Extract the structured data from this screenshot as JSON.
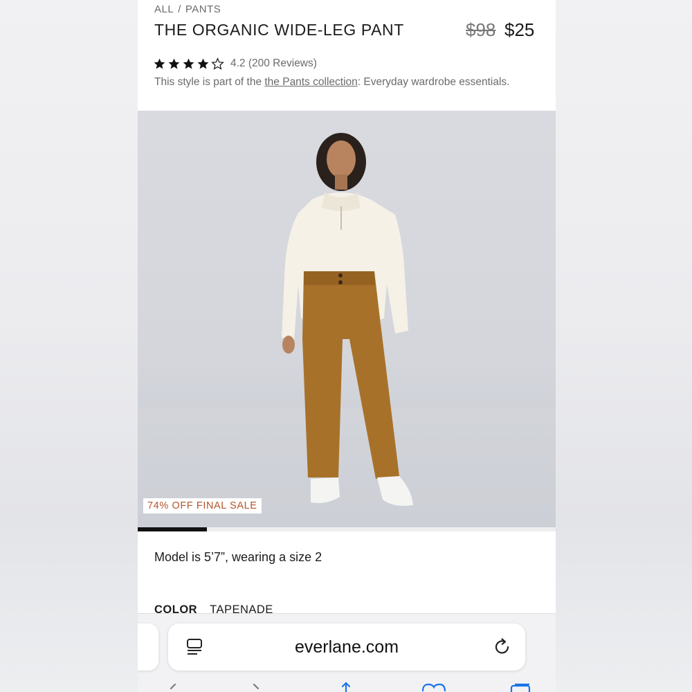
{
  "breadcrumb": {
    "all": "ALL",
    "separator": "/",
    "category": "PANTS"
  },
  "product": {
    "title": "THE ORGANIC WIDE-LEG PANT",
    "original_price": "$98",
    "sale_price": "$25",
    "rating_stars": 4,
    "rating_text": "4.2 (200 Reviews)",
    "collection_prefix": "This style is part of the ",
    "collection_link": "the Pants collection",
    "collection_suffix": ": Everyday wardrobe essentials."
  },
  "gallery": {
    "badge": "74% OFF FINAL SALE",
    "progress": 0.166
  },
  "model_info": "Model is 5’7”, wearing a size 2",
  "color": {
    "label": "COLOR",
    "value": "TAPENADE"
  },
  "browser": {
    "domain": "everlane.com"
  },
  "colors": {
    "accent_sale": "#b3532b",
    "pants": "#a8712a",
    "top": "#f5f1e6",
    "background": "#d6d8dd"
  },
  "icons": [
    "star-icon",
    "reader-mode-icon",
    "reload-icon",
    "back-icon",
    "forward-icon",
    "share-icon",
    "bookmarks-icon",
    "tabs-icon"
  ]
}
